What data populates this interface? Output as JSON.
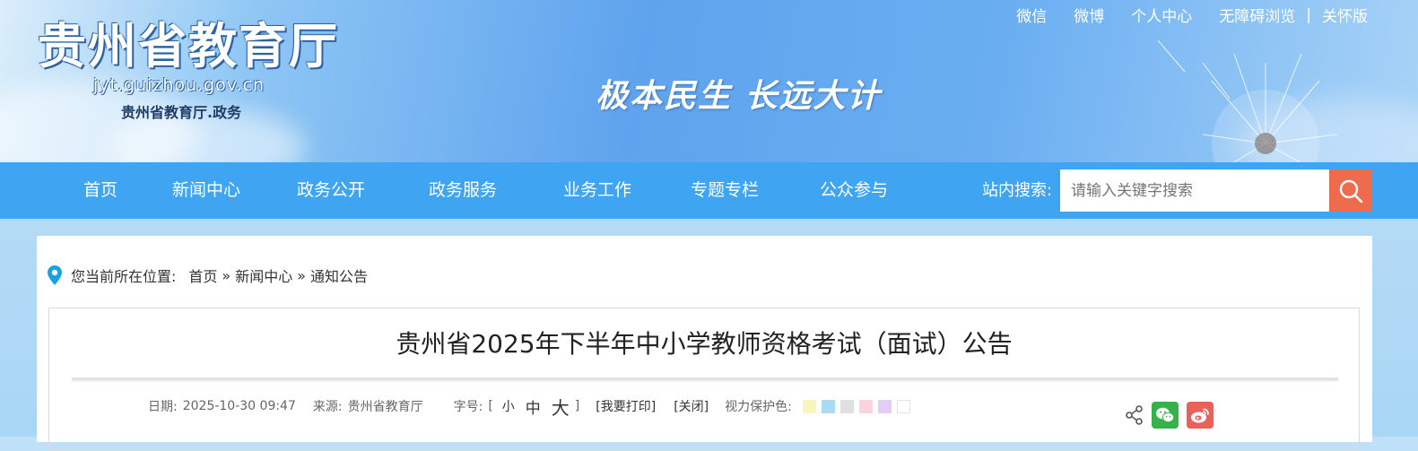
{
  "header": {
    "site_title": "贵州省教育厅",
    "site_url": "jyt.guizhou.gov.cn",
    "site_subtitle": "贵州省教育厅.政务",
    "slogan": "极本民生 长远大计",
    "top_links": {
      "wechat": "微信",
      "weibo": "微博",
      "personal_center": "个人中心",
      "accessible": "无障碍浏览",
      "separator": "|",
      "care_version": "关怀版"
    }
  },
  "nav": {
    "items": [
      "首页",
      "新闻中心",
      "政务公开",
      "政务服务",
      "业务工作",
      "专题专栏",
      "公众参与"
    ],
    "search_label": "站内搜索:",
    "search_placeholder": "请输入关键字搜索"
  },
  "breadcrumb": {
    "prefix": "您当前所在位置:",
    "items": [
      "首页",
      "新闻中心",
      "通知公告"
    ],
    "separator": "»"
  },
  "article": {
    "title": "贵州省2025年下半年中小学教师资格考试（面试）公告",
    "date_label": "日期:",
    "date": "2025-10-30 09:47",
    "source_label": "来源:",
    "source": "贵州省教育厅",
    "fontsize_label": "字号:",
    "bracket_open": "[",
    "bracket_close": "]",
    "font_small": "小",
    "font_medium": "中",
    "font_large": "大",
    "print": "[我要打印]",
    "close": "[关闭]",
    "eye_care_label": "视力保护色:",
    "eye_care_colors": [
      "#faf5bf",
      "#a9dcf4",
      "#e0e0e0",
      "#fbd3dd",
      "#e2cdf7",
      "#ffffff"
    ]
  },
  "share": {
    "icons": [
      "share-icon",
      "wechat-icon",
      "weibo-icon"
    ],
    "wechat_color": "#35b34a",
    "weibo_color": "#e9625a"
  }
}
